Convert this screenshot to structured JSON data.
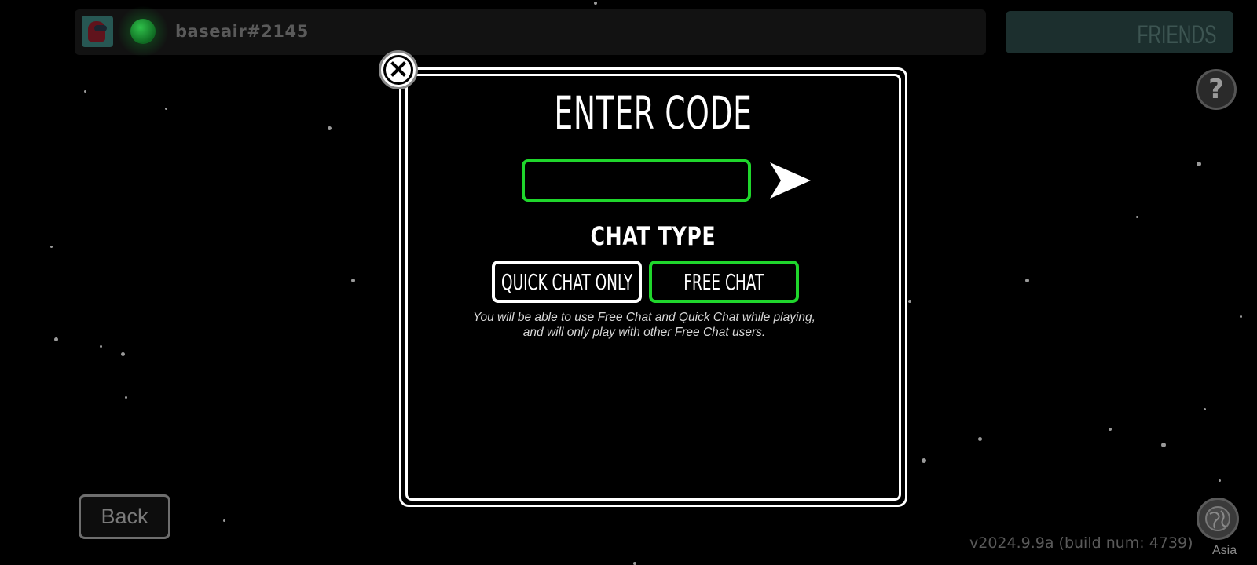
{
  "profile": {
    "username": "baseair#2145",
    "avatar_icon": "crewmate-icon",
    "status_icon": "online-status-icon",
    "status_color": "#1fbf3a"
  },
  "friends": {
    "label": "FRIENDS"
  },
  "help": {
    "label": "?",
    "icon": "question-icon"
  },
  "dialog": {
    "close_icon": "close-icon",
    "title": "ENTER CODE",
    "code_input": {
      "value": "",
      "placeholder": ""
    },
    "submit_icon": "arrow-right-icon",
    "chat_type": {
      "heading": "CHAT TYPE",
      "options": [
        "QUICK CHAT ONLY",
        "FREE CHAT"
      ],
      "selected": "FREE CHAT",
      "description": "You will be able to use Free Chat and Quick Chat while playing, and will only play with other Free Chat users."
    }
  },
  "back": {
    "label": "Back"
  },
  "version": "v2024.9.9a (build num: 4739)",
  "region": {
    "icon": "globe-icon",
    "label": "Asia"
  },
  "colors": {
    "accent_green": "#1fd62c",
    "background": "#000000",
    "modal_border": "#ffffff"
  }
}
